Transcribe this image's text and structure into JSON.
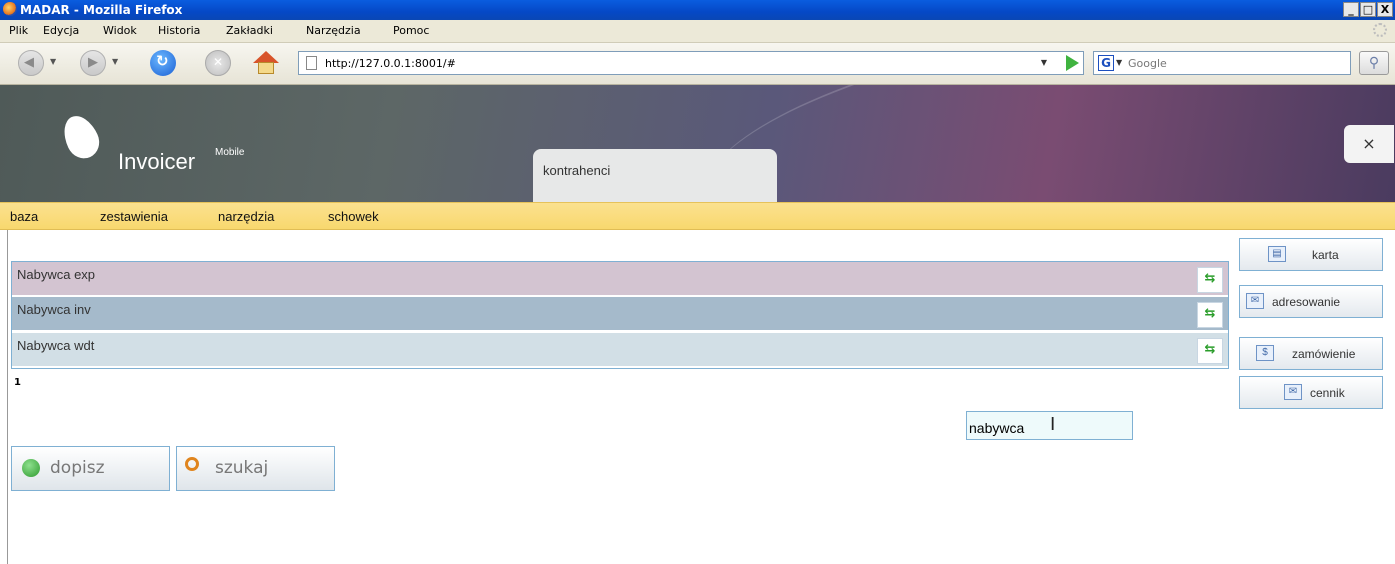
{
  "window": {
    "title": "MADAR - Mozilla Firefox",
    "controls": [
      "_",
      "□",
      "X"
    ]
  },
  "menubar": [
    "Plik",
    "Edycja",
    "Widok",
    "Historia",
    "Zakładki",
    "Narzędzia",
    "Pomoc"
  ],
  "navbar": {
    "url": "http://127.0.0.1:8001/#",
    "search_placeholder": "Google",
    "search_engine_letter": "G"
  },
  "app": {
    "logo": "Invoicer",
    "logo_sup": "Mobile",
    "active_tab": "kontrahenci",
    "close_symbol": "×",
    "menu": [
      "baza",
      "zestawienia",
      "narzędzia",
      "schowek"
    ]
  },
  "list": {
    "rows": [
      {
        "label": "Nabywca exp",
        "color": "#d3c4d1"
      },
      {
        "label": "Nabywca inv",
        "color": "#a5bacb"
      },
      {
        "label": "Nabywca wdt",
        "color": "#d2dfe6"
      }
    ],
    "page": "1"
  },
  "side_buttons": [
    {
      "label": "karta",
      "icon": "card-icon"
    },
    {
      "label": "adresowanie",
      "icon": "envelope-icon"
    },
    {
      "label": "zamówienie",
      "icon": "order-icon"
    },
    {
      "label": "cennik",
      "icon": "pricelist-icon"
    }
  ],
  "filter": {
    "value": "nabywca"
  },
  "actions": {
    "add": "dopisz",
    "search": "szukaj"
  },
  "colors": {
    "accent_border": "#7fb0d3",
    "menu_bg": "#f8d86e",
    "xp_title": "#0548c6"
  }
}
